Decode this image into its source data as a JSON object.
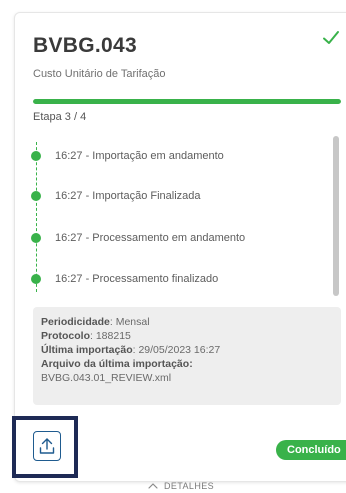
{
  "card": {
    "title": "BVBG.043",
    "subtitle": "Custo Unitário de Tarifação",
    "progress_fraction": 1.0,
    "stage": "Etapa 3 / 4",
    "status_badge": "Concluído",
    "details_label": "DETALHES"
  },
  "timeline": [
    {
      "text": "16:27 - Importação em andamento"
    },
    {
      "text": "16:27 - Importação Finalizada"
    },
    {
      "text": "16:27 - Processamento em andamento"
    },
    {
      "text": "16:27 - Processamento finalizado"
    }
  ],
  "info": {
    "periodicidade_label": "Periodicidade",
    "periodicidade_value": "Mensal",
    "protocolo_label": "Protocolo",
    "protocolo_value": "188215",
    "ultima_label": "Última importação",
    "ultima_value": "29/05/2023 16:27",
    "arquivo_label": "Arquivo da última importação:",
    "arquivo_value": "BVBG.043.01_REVIEW.xml"
  },
  "colors": {
    "accent_green": "#39b24a",
    "navy_frame": "#1e2a55",
    "upload_blue": "#1f5b8f"
  },
  "icons": {
    "status": "check-icon",
    "upload": "upload-icon",
    "expand": "chevron-up-icon"
  }
}
